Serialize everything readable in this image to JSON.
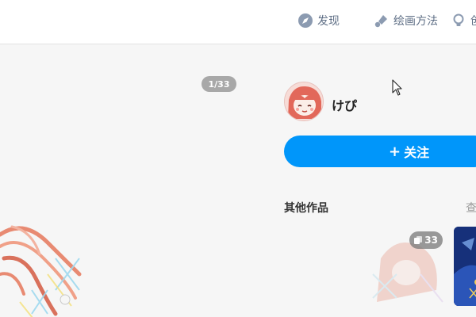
{
  "nav": {
    "discover_label": "发现",
    "howto_label": "绘画方法",
    "create_label": "创",
    "discover_icon": "compass-icon",
    "howto_icon": "brush-icon",
    "create_icon": "lightbulb-icon",
    "color": "#5f6f86"
  },
  "artwork": {
    "page_counter": "1/33"
  },
  "author": {
    "name": "けぴ",
    "avatar_icon": "avatar"
  },
  "follow": {
    "label": "关注",
    "plus": "+",
    "color": "#0096fa"
  },
  "other_works": {
    "title": "其他作品",
    "view_all_label": "查",
    "thumbs": [
      {
        "page_count": "33",
        "icon": "pages-icon"
      },
      {
        "page_count": null
      }
    ]
  }
}
